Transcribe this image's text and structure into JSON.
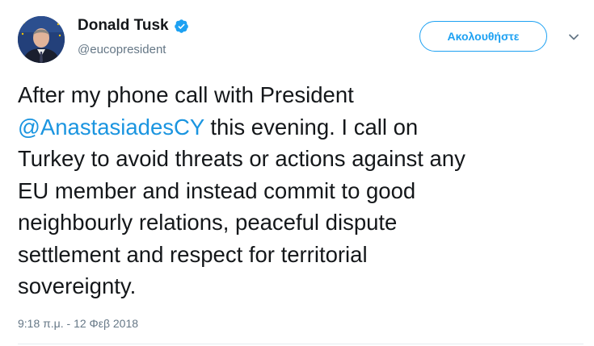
{
  "author": {
    "display_name": "Donald Tusk",
    "handle": "@eucopresident",
    "verified": true
  },
  "follow_button": {
    "label": "Ακολουθήστε"
  },
  "tweet": {
    "line1": "After my phone call with President",
    "mention": "@AnastasiadesCY",
    "line2_rest": " this evening. I call on",
    "line3": "Turkey to avoid threats or actions against any",
    "line4": "EU member and instead commit to good",
    "line5": "neighbourly relations, peaceful dispute",
    "line6": "settlement and respect for territorial",
    "line7": "sovereignty."
  },
  "timestamp": "9:18 π.μ. - 12 Φεβ 2018",
  "icons": {
    "verified": "verified-badge-icon",
    "caret": "chevron-down-icon"
  },
  "colors": {
    "accent": "#1da1f2",
    "mention": "#1b95e0",
    "text": "#14171a",
    "secondary": "#657786"
  }
}
